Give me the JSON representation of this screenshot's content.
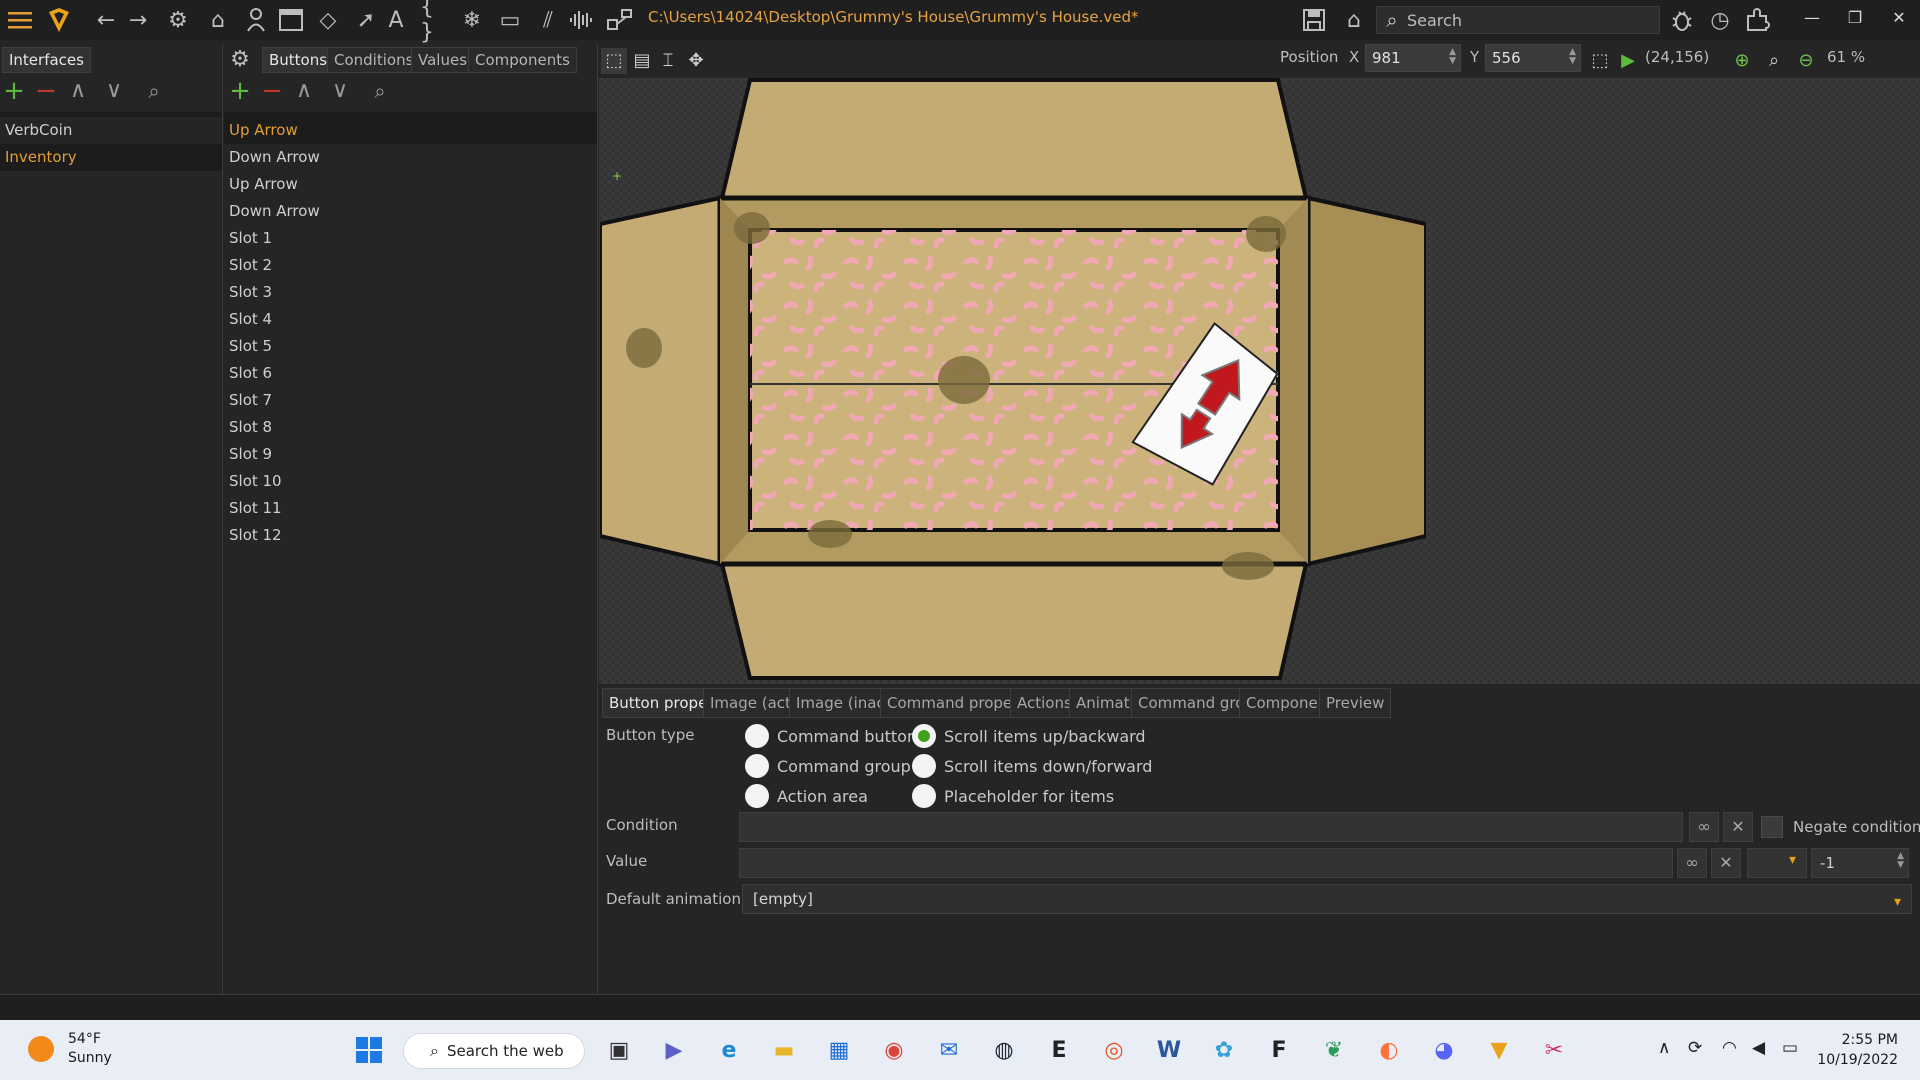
{
  "titlebar": {
    "path": "C:\\Users\\14024\\Desktop\\Grummy's House\\Grummy's House.ved*",
    "search_placeholder": "Search",
    "icons": [
      "menu-icon",
      "app-logo-icon",
      "back-icon",
      "forward-icon",
      "settings-icon",
      "home-icon",
      "character-icon",
      "window-icon",
      "diamond-icon",
      "cursor-icon",
      "font-icon",
      "script-braces-icon",
      "snowflake-icon",
      "dialog-icon",
      "hatch-icon",
      "audio-icon",
      "share-icon",
      "save-icon",
      "home-save-icon",
      "bug-icon",
      "timer-icon",
      "puzzle-icon"
    ]
  },
  "left_panel": {
    "tab": "Interfaces",
    "items": [
      {
        "label": "VerbCoin",
        "selected": false
      },
      {
        "label": "Inventory",
        "selected": true
      }
    ]
  },
  "mid_panel": {
    "tabs": [
      "Buttons",
      "Conditions",
      "Values",
      "Components"
    ],
    "active_tab": "Buttons",
    "items": [
      "Up Arrow",
      "Down Arrow",
      "Up Arrow",
      "Down Arrow",
      "Slot 1",
      "Slot 2",
      "Slot 3",
      "Slot 4",
      "Slot 5",
      "Slot 6",
      "Slot 7",
      "Slot 8",
      "Slot 9",
      "Slot 10",
      "Slot 11",
      "Slot 12"
    ],
    "selected_index": 0
  },
  "canvas_toolbar": {
    "position_label": "Position",
    "x_label": "X",
    "x_value": "981",
    "y_label": "Y",
    "y_value": "556",
    "size_readout": "(24,156)",
    "zoom": "61 %"
  },
  "properties": {
    "tabs": [
      "Button properties",
      "Image (active)",
      "Image (inactive)",
      "Command properties",
      "Actions",
      "Animations",
      "Command group",
      "Components",
      "Preview"
    ],
    "active_tab": "Button properties",
    "button_type_label": "Button type",
    "radios": [
      {
        "label": "Command button",
        "checked": false
      },
      {
        "label": "Command group",
        "checked": false
      },
      {
        "label": "Action area",
        "checked": false
      },
      {
        "label": "Scroll items up/backward",
        "checked": true
      },
      {
        "label": "Scroll items down/forward",
        "checked": false
      },
      {
        "label": "Placeholder for items",
        "checked": false
      }
    ],
    "condition_label": "Condition",
    "negate_label": "Negate condition",
    "value_label": "Value",
    "value_number": "-1",
    "default_animation_label": "Default animation",
    "default_animation_value": "[empty]"
  },
  "taskbar": {
    "weather_temp": "54°F",
    "weather_desc": "Sunny",
    "search_label": "Search the web",
    "time": "2:55 PM",
    "date": "10/19/2022",
    "apps": [
      "start-icon",
      "task-view-icon",
      "teams-icon",
      "edge-icon",
      "file-explorer-icon",
      "store-icon",
      "chrome-icon",
      "mail-icon",
      "steam-icon",
      "epic-games-icon",
      "ubuntu-icon",
      "word-icon",
      "photos-icon",
      "fl-studio-icon",
      "feather-icon",
      "firefox-icon",
      "discord-icon",
      "visionaire-icon",
      "snipping-tool-icon"
    ]
  },
  "colors": {
    "accent_orange": "#e49c36",
    "add_green": "#5dbb3a",
    "remove_red": "#c0392b",
    "box_tan": "#c8b07a",
    "box_dark": "#a68e55"
  }
}
